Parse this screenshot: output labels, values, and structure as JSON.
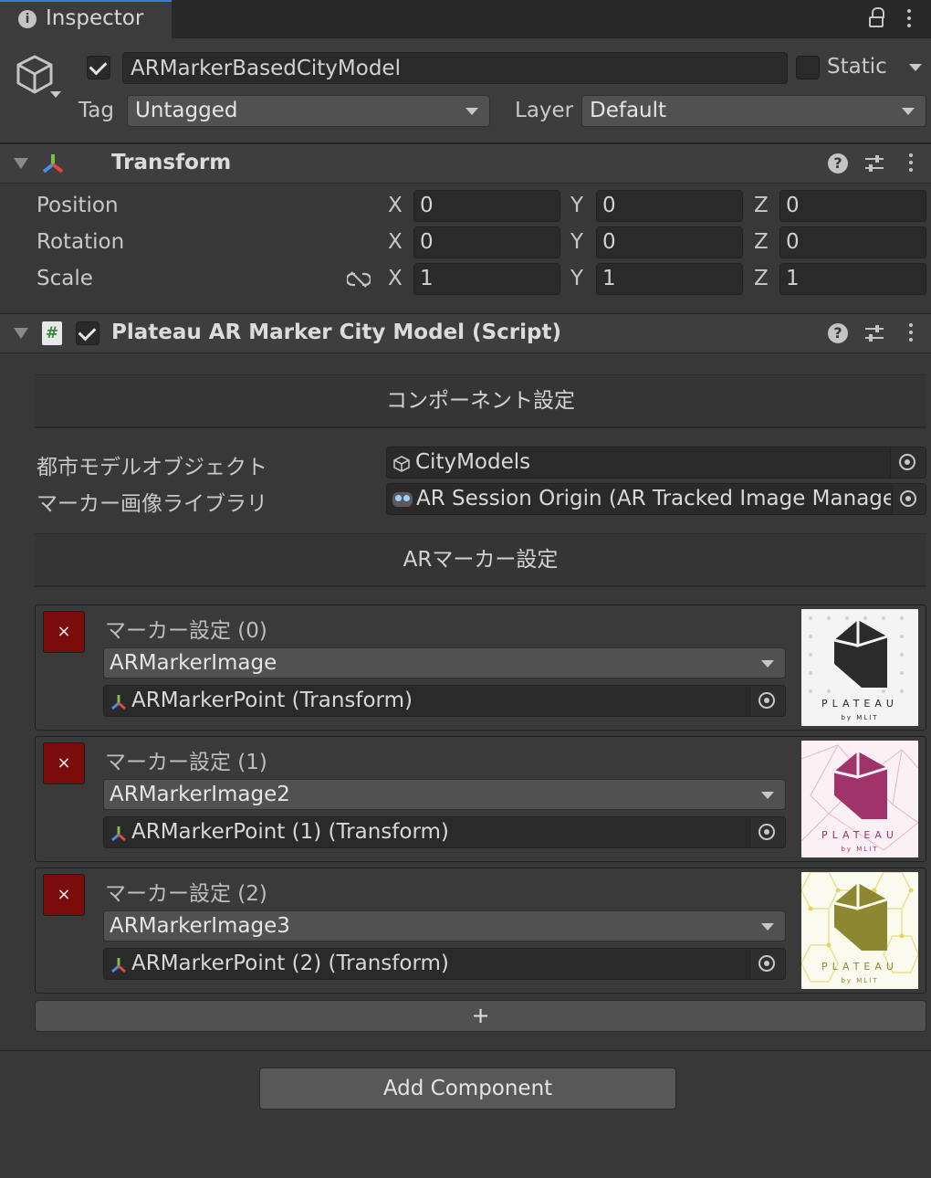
{
  "tab": {
    "title": "Inspector",
    "icon": "info-icon"
  },
  "object": {
    "name": "ARMarkerBasedCityModel",
    "static_label": "Static",
    "tag_label": "Tag",
    "tag_value": "Untagged",
    "layer_label": "Layer",
    "layer_value": "Default"
  },
  "transform": {
    "title": "Transform",
    "rows": [
      {
        "label": "Position",
        "x": "0",
        "y": "0",
        "z": "0"
      },
      {
        "label": "Rotation",
        "x": "0",
        "y": "0",
        "z": "0"
      },
      {
        "label": "Scale",
        "x": "1",
        "y": "1",
        "z": "1"
      }
    ],
    "axis_x": "X",
    "axis_y": "Y",
    "axis_z": "Z"
  },
  "script": {
    "title": "Plateau AR Marker City Model (Script)",
    "section1": "コンポーネント設定",
    "city_label": "都市モデルオブジェクト",
    "city_value": "CityModels",
    "library_label": "マーカー画像ライブラリ",
    "library_value": "AR Session Origin (AR Tracked Image Manager",
    "section2": "ARマーカー設定",
    "markers": [
      {
        "label": "マーカー設定 (0)",
        "image": "ARMarkerImage",
        "point": "ARMarkerPoint (Transform)",
        "color": "#2b2b2b"
      },
      {
        "label": "マーカー設定 (1)",
        "image": "ARMarkerImage2",
        "point": "ARMarkerPoint (1) (Transform)",
        "color": "#a0336a"
      },
      {
        "label": "マーカー設定 (2)",
        "image": "ARMarkerImage3",
        "point": "ARMarkerPoint (2) (Transform)",
        "color": "#8c8730"
      }
    ],
    "thumb_brand": "PLATEAU",
    "thumb_sub": "by MLIT",
    "add_marker": "+"
  },
  "add_component": "Add Component",
  "remove_glyph": "×"
}
